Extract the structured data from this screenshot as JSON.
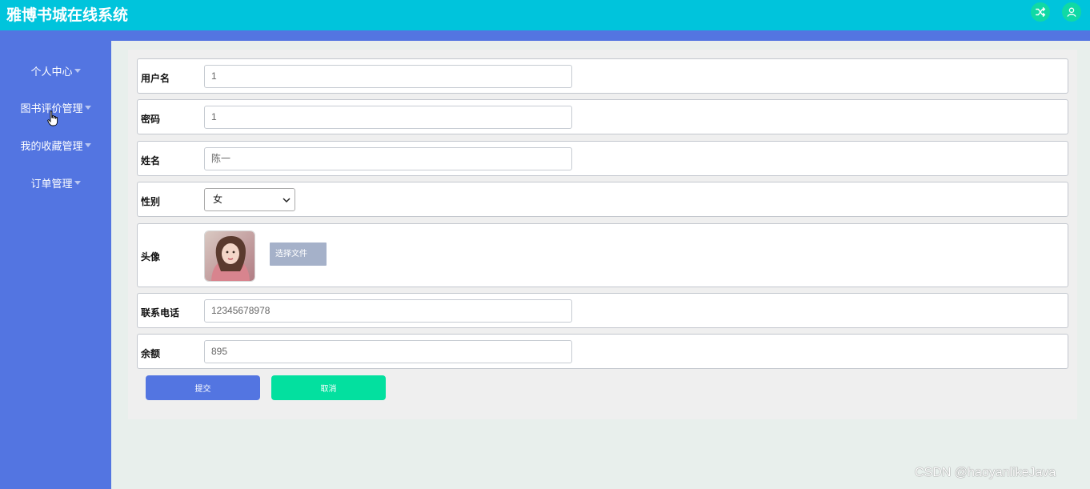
{
  "app": {
    "title": "雅博书城在线系统"
  },
  "header": {
    "icons": [
      "shuffle-icon",
      "user-icon"
    ],
    "accent": "#00c4dc",
    "icon_bg": "#10d9a5"
  },
  "sidebar": {
    "bg": "#5375e1",
    "items": [
      {
        "label": "个人中心"
      },
      {
        "label": "图书评价管理"
      },
      {
        "label": "我的收藏管理"
      },
      {
        "label": "订单管理"
      }
    ]
  },
  "form": {
    "username": {
      "label": "用户名",
      "value": "1"
    },
    "password": {
      "label": "密码",
      "value": "1"
    },
    "name": {
      "label": "姓名",
      "value": "陈一"
    },
    "gender": {
      "label": "性别",
      "selected": "女"
    },
    "avatar": {
      "label": "头像",
      "button": "选择文件"
    },
    "phone": {
      "label": "联系电话",
      "value": "12345678978"
    },
    "balance": {
      "label": "余额",
      "value": "895"
    }
  },
  "actions": {
    "submit": "提交",
    "cancel": "取消"
  },
  "watermark": "CSDN @haoyanlikeJava"
}
